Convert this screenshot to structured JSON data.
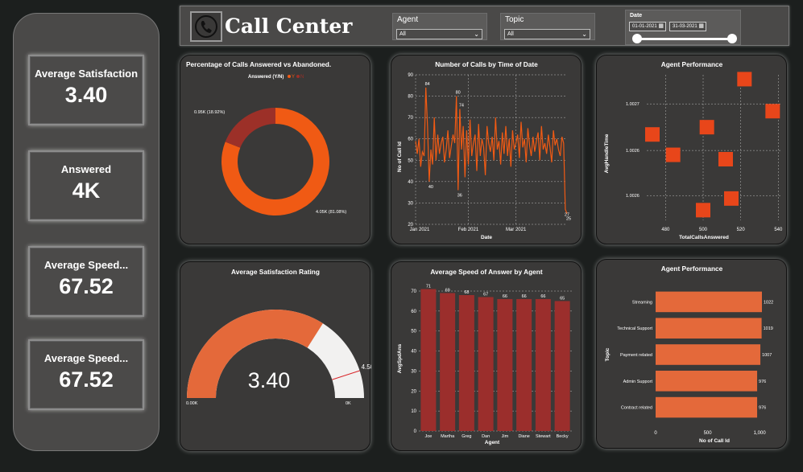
{
  "header": {
    "title": "Call Center",
    "agent_slicer": {
      "label": "Agent",
      "value": "All"
    },
    "topic_slicer": {
      "label": "Topic",
      "value": "All"
    },
    "date_slicer": {
      "label": "Date",
      "start": "01-01-2021",
      "end": "31-03-2021"
    }
  },
  "kpis": [
    {
      "label": "Average Satisfaction",
      "value": "3.40"
    },
    {
      "label": "Answered",
      "value": "4K"
    },
    {
      "label": "Average Speed...",
      "value": "67.52"
    },
    {
      "label": "Average Speed...",
      "value": "67.52"
    }
  ],
  "colors": {
    "accent": "#f05a14",
    "bar_red": "#9b2e2c",
    "bar_orange": "#e4693a",
    "donut_n": "#9c3028",
    "gauge_fill": "#e4693a",
    "gauge_bg": "#f2f1f0",
    "gauge_target": "#d9262a"
  },
  "chart_data": [
    {
      "id": "donut",
      "type": "pie",
      "title": "Percentage of Calls Answered vs Abandoned.",
      "legend_title": "Answered (Y/N)",
      "legend_position": "top",
      "slices": [
        {
          "name": "Y",
          "value": 4050,
          "label": "4.05K (81.08%)"
        },
        {
          "name": "N",
          "value": 950,
          "label": "0.95K (18.92%)"
        }
      ]
    },
    {
      "id": "calls_by_date",
      "type": "line",
      "title": "Number of Calls by Time of Date",
      "xlabel": "Date",
      "ylabel": "No of Call Id",
      "ylim": [
        20,
        90
      ],
      "yticks": [
        20,
        30,
        40,
        50,
        60,
        70,
        80,
        90
      ],
      "xticks": [
        "Jan 2021",
        "Feb 2021",
        "Mar 2021"
      ],
      "x_range": [
        "2021-01-01",
        "2021-03-31"
      ],
      "grid": true,
      "values": [
        59,
        53,
        60,
        47,
        54,
        52,
        84,
        66,
        40,
        55,
        48,
        70,
        50,
        62,
        53,
        58,
        61,
        49,
        55,
        64,
        51,
        57,
        62,
        58,
        80,
        36,
        74,
        55,
        66,
        42,
        64,
        48,
        69,
        52,
        58,
        62,
        45,
        67,
        52,
        60,
        56,
        43,
        66,
        58,
        54,
        61,
        50,
        70,
        55,
        59,
        48,
        63,
        53,
        66,
        52,
        60,
        47,
        64,
        55,
        58,
        62,
        51,
        68,
        56,
        60,
        49,
        65,
        57,
        52,
        61,
        54,
        59,
        63,
        50,
        66,
        55,
        58,
        53,
        62,
        56,
        49,
        64,
        57,
        60,
        55,
        52,
        61,
        58,
        27,
        25
      ],
      "annotations": [
        {
          "index": 6,
          "text": "84"
        },
        {
          "index": 8,
          "text": "40"
        },
        {
          "index": 24,
          "text": "80"
        },
        {
          "index": 25,
          "text": "36"
        },
        {
          "index": 26,
          "text": "74"
        },
        {
          "index": 88,
          "text": "27"
        },
        {
          "index": 89,
          "text": "25"
        }
      ]
    },
    {
      "id": "agent_perf_scatter",
      "type": "scatter",
      "title": "Agent Performance",
      "xlabel": "TotalCallsAnswered",
      "ylabel": "AvgHandleTime",
      "xticks": [
        480,
        500,
        520,
        540
      ],
      "xlim": [
        470,
        542
      ],
      "yticks": [
        "1.0026",
        "1.0026",
        "1.0027"
      ],
      "ylim": [
        0,
        1
      ],
      "grid": true,
      "points": [
        {
          "x": 473,
          "y": 0.59
        },
        {
          "x": 484,
          "y": 0.45
        },
        {
          "x": 500,
          "y": 0.07
        },
        {
          "x": 502,
          "y": 0.64
        },
        {
          "x": 512,
          "y": 0.42
        },
        {
          "x": 515,
          "y": 0.15
        },
        {
          "x": 522,
          "y": 0.97
        },
        {
          "x": 537,
          "y": 0.75
        }
      ]
    },
    {
      "id": "gauge",
      "type": "gauge",
      "title": "Average Satisfaction Rating",
      "value": 3.4,
      "value_label": "3.40",
      "min": 0,
      "max": 5,
      "min_label": "0.00K",
      "max_label": "0K",
      "target": 4.5,
      "target_label": "4.50"
    },
    {
      "id": "speed_by_agent",
      "type": "bar",
      "title": "Average Speed of Answer by Agent",
      "xlabel": "Agent",
      "ylabel": "AvgSpdAns",
      "ylim": [
        0,
        70
      ],
      "yticks": [
        0,
        10,
        20,
        30,
        40,
        50,
        60,
        70
      ],
      "categories": [
        "Joe",
        "Martha",
        "Greg",
        "Dan",
        "Jim",
        "Diane",
        "Stewart",
        "Becky"
      ],
      "values": [
        71,
        69,
        68,
        67,
        66,
        66,
        66,
        65
      ],
      "data_labels": [
        "71",
        "69",
        "68",
        "67",
        "66",
        "66",
        "66",
        "65"
      ]
    },
    {
      "id": "agent_perf_topic",
      "type": "bar",
      "orientation": "horizontal",
      "title": "Agent Performance",
      "xlabel": "No of Call Id",
      "ylabel": "Topic",
      "xlim": [
        0,
        1022
      ],
      "xticks": [
        0,
        500,
        1000
      ],
      "xtick_labels": [
        "0",
        "500",
        "1,000"
      ],
      "categories": [
        "Streaming",
        "Technical Support",
        "Payment related",
        "Admin Support",
        "Contract related"
      ],
      "values": [
        1022,
        1019,
        1007,
        976,
        976
      ],
      "data_labels": [
        "1022",
        "1019",
        "1007",
        "976",
        "976"
      ]
    }
  ]
}
